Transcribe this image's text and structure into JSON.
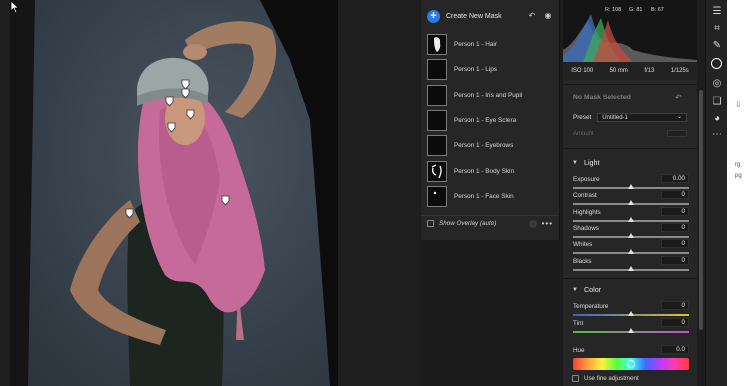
{
  "masks_panel": {
    "create_label": "Create New Mask",
    "masks": [
      {
        "label": "Person 1 - Hair"
      },
      {
        "label": "Person 1 - Lips"
      },
      {
        "label": "Person 1 - Iris and Pupil"
      },
      {
        "label": "Person 1 - Eye Sclera"
      },
      {
        "label": "Person 1 - Eyebrows"
      },
      {
        "label": "Person 1 - Body Skin"
      },
      {
        "label": "Person 1 - Face Skin"
      }
    ],
    "overlay_label": "Show Overlay (auto)",
    "more_label": "•••"
  },
  "histogram": {
    "r_label": "R: 108",
    "g_label": "G: 81",
    "b_label": "B: 67"
  },
  "exif": {
    "iso": "ISO 100",
    "focal": "50 mm",
    "aperture": "f/13",
    "shutter": "1/125s"
  },
  "properties": {
    "no_mask": "No Mask Selected",
    "preset_label": "Preset",
    "preset_value": "Untitled-1",
    "amount_label": "Amount",
    "light_heading": "Light",
    "light_sliders": [
      {
        "label": "Exposure",
        "value": "0.00"
      },
      {
        "label": "Contrast",
        "value": "0"
      },
      {
        "label": "Highlights",
        "value": "0"
      },
      {
        "label": "Shadows",
        "value": "0"
      },
      {
        "label": "Whites",
        "value": "0"
      },
      {
        "label": "Blacks",
        "value": "0"
      }
    ],
    "color_heading": "Color",
    "color_sliders": [
      {
        "label": "Temperature",
        "value": "0"
      },
      {
        "label": "Tint",
        "value": "0"
      }
    ],
    "hue_label": "Hue",
    "hue_value": "0.0",
    "fine_label": "Use fine adjustment"
  },
  "doc_fragments": [
    "rg",
    "pg"
  ],
  "colors": {
    "accent": "#2a7bde",
    "panel": "#262626",
    "hair": "#c66a9a"
  },
  "tool_icons": [
    "sliders-icon",
    "crop-icon",
    "healing-brush-icon",
    "masking-icon",
    "red-eye-icon",
    "presets-icon",
    "versions-icon",
    "more-icon"
  ]
}
